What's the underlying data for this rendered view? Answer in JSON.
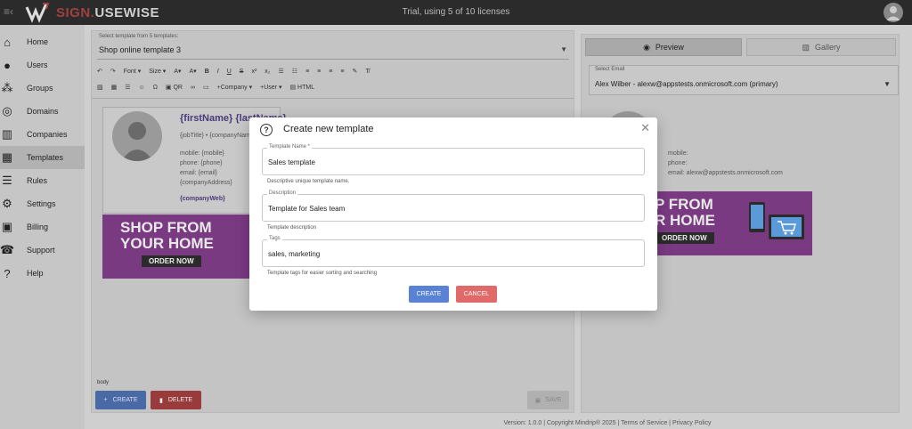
{
  "app": {
    "brand_prefix": "SIGN.",
    "brand_suffix": "USEWISE",
    "trial_text": "Trial, using 5 of 10 licenses"
  },
  "sidebar": {
    "items": [
      {
        "label": "Home",
        "icon": "home-icon"
      },
      {
        "label": "Users",
        "icon": "user-icon"
      },
      {
        "label": "Groups",
        "icon": "groups-icon"
      },
      {
        "label": "Domains",
        "icon": "globe-icon"
      },
      {
        "label": "Companies",
        "icon": "buildings-icon"
      },
      {
        "label": "Templates",
        "icon": "template-icon"
      },
      {
        "label": "Rules",
        "icon": "rules-icon"
      },
      {
        "label": "Settings",
        "icon": "gear-icon"
      },
      {
        "label": "Billing",
        "icon": "wallet-icon"
      },
      {
        "label": "Support",
        "icon": "support-icon"
      },
      {
        "label": "Help",
        "icon": "help-icon"
      }
    ],
    "active": "Templates"
  },
  "editor": {
    "select_label": "Select template from 5 templates:",
    "select_value": "Shop online template 3",
    "toolbar": {
      "undo": "↶",
      "redo": "↷",
      "font": "Font",
      "size": "Size",
      "company": "+Company",
      "user": "+User",
      "html": "HTML",
      "qr": "QR"
    },
    "signature": {
      "name": "{firstName} {lastName}",
      "job": "{jobTitle} • {companyName}",
      "mobile": "mobile: {mobile}",
      "phone": "phone: {phone}",
      "email": "email: {email}",
      "address": "{companyAddress}",
      "web": "{companyWeb}"
    },
    "banner": {
      "line1": "SHOP FROM",
      "line2": "YOUR HOME",
      "cta": "ORDER NOW"
    },
    "body_tag": "body",
    "create_label": "CREATE",
    "delete_label": "DELETE",
    "save_label": "SAVE"
  },
  "preview": {
    "tab_preview": "Preview",
    "tab_gallery": "Gallery",
    "email_label": "Select Email",
    "email_value": "Alex Wilber - alexw@appstests.onmicrosoft.com (primary)",
    "mobile": "mobile:",
    "phone": "phone:",
    "email": "email: alexw@appstests.onmicrosoft.com",
    "banner_line1": "P FROM",
    "banner_line2": "R HOME",
    "banner_cta": "ORDER NOW"
  },
  "footer": {
    "text": "Version: 1.0.0  |  Copyright Mindrip® 2025  |  Terms of Service  |  Privacy Policy"
  },
  "modal": {
    "title": "Create new template",
    "name_label": "Template Name *",
    "name_value": "Sales template",
    "name_help": "Descriptive unique template name.",
    "desc_label": "Description",
    "desc_value": "Template for Sales team",
    "desc_help": "Template description",
    "tags_label": "Tags",
    "tags_value": "sales, marketing",
    "tags_help": "Template tags for easier sorting and searching",
    "create": "CREATE",
    "cancel": "CANCEL"
  },
  "colors": {
    "create": "#5a82d4",
    "cancel": "#e06a6a",
    "banner": "#7a3a82",
    "topbar": "#2b2b2b"
  }
}
